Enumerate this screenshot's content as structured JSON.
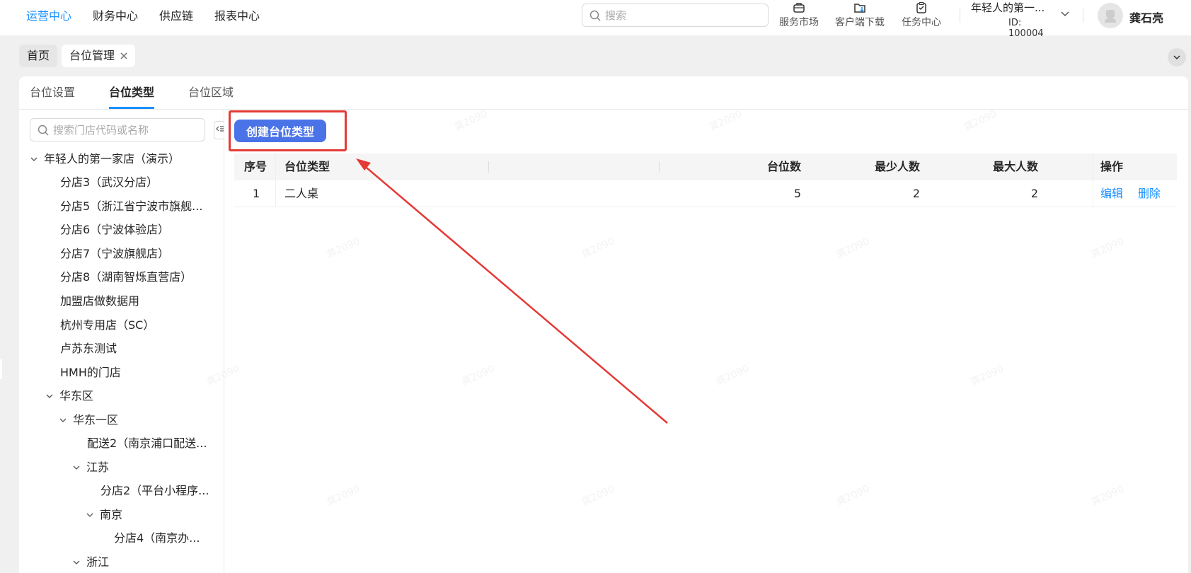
{
  "topnav": {
    "items": [
      {
        "label": "运营中心",
        "active": true
      },
      {
        "label": "财务中心",
        "active": false
      },
      {
        "label": "供应链",
        "active": false
      },
      {
        "label": "报表中心",
        "active": false
      }
    ]
  },
  "search": {
    "placeholder": "搜索"
  },
  "tools": {
    "market": "服务市场",
    "download": "客户端下载",
    "tasks": "任务中心"
  },
  "org": {
    "name": "年轻人的第一...",
    "id": "ID: 100004"
  },
  "user": {
    "name": "龚石亮"
  },
  "pagetabs": {
    "home": "首页",
    "current": "台位管理"
  },
  "subtabs": [
    "台位设置",
    "台位类型",
    "台位区域"
  ],
  "tree": {
    "search_placeholder": "搜索门店代码或名称",
    "nodes": [
      "年轻人的第一家店（演示）",
      "分店3（武汉分店）",
      "分店5（浙江省宁波市旗舰...",
      "分店6（宁波体验店）",
      "分店7（宁波旗舰店）",
      "分店8（湖南智烁直营店）",
      "加盟店做数据用",
      "杭州专用店（SC）",
      "卢苏东测试",
      "HMH的门店",
      "华东区",
      "华东一区",
      "配送2（南京浦口配送...",
      "江苏",
      "分店2（平台小程序...",
      "南京",
      "分店4（南京办...",
      "浙江"
    ]
  },
  "toolbar": {
    "create_label": "创建台位类型"
  },
  "table": {
    "headers": [
      "序号",
      "台位类型",
      "台位数",
      "最少人数",
      "最大人数",
      "操作"
    ],
    "rows": [
      {
        "index": "1",
        "type": "二人桌",
        "count": "5",
        "min": "2",
        "max": "2",
        "edit": "编辑",
        "delete": "删除"
      }
    ]
  },
  "watermark": "龚2090",
  "colors": {
    "primary": "#1890ff",
    "button": "#4a73e8",
    "annotation": "#e53935"
  }
}
